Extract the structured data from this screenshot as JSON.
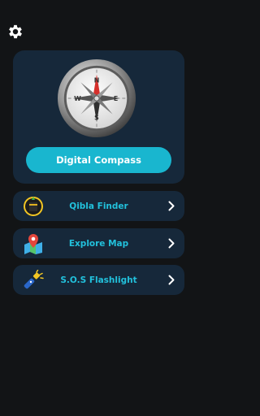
{
  "icons": {
    "settings": "gear-icon",
    "compass": "compass-icon",
    "qibla": "kaaba-icon",
    "map": "map-pin-icon",
    "flashlight": "flashlight-icon",
    "chevron": "chevron-right-icon"
  },
  "hero": {
    "compass_letters": {
      "north": "N",
      "south": "S",
      "east": "E",
      "west": "W"
    },
    "button_label": "Digital Compass"
  },
  "menu": [
    {
      "label": "Qibla Finder"
    },
    {
      "label": "Explore Map"
    },
    {
      "label": "S.O.S Flashlight"
    }
  ],
  "colors": {
    "background": "#121416",
    "card": "#16283a",
    "accent": "#19b6cf",
    "accent_text": "#22c1dc"
  }
}
